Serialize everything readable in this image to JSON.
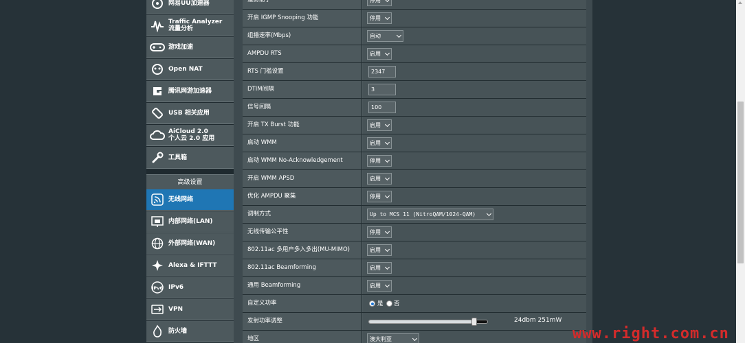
{
  "sidebar": {
    "items": [
      {
        "label": "网易UU加速器",
        "icon": "uu-icon"
      },
      {
        "label": "Traffic Analyzer\n流量分析",
        "icon": "traffic-analyzer-icon"
      },
      {
        "label": "游戏加速",
        "icon": "gamepad-icon"
      },
      {
        "label": "Open NAT",
        "icon": "open-nat-icon"
      },
      {
        "label": "腾讯网游加速器",
        "icon": "tencent-game-icon"
      },
      {
        "label": "USB 相关应用",
        "icon": "usb-icon"
      },
      {
        "label": "AiCloud 2.0\n个人云 2.0 应用",
        "icon": "cloud-icon"
      },
      {
        "label": "工具箱",
        "icon": "wrench-icon"
      }
    ],
    "advanced_header": "高级设置",
    "advanced_items": [
      {
        "label": "无线网络",
        "icon": "wifi-icon",
        "active": true
      },
      {
        "label": "内部网络(LAN)",
        "icon": "lan-icon"
      },
      {
        "label": "外部网络(WAN)",
        "icon": "globe-icon"
      },
      {
        "label": "Alexa & IFTTT",
        "icon": "alexa-icon"
      },
      {
        "label": "IPv6",
        "icon": "ipv6-icon"
      },
      {
        "label": "VPN",
        "icon": "vpn-icon"
      },
      {
        "label": "防火墙",
        "icon": "firewall-icon"
      }
    ]
  },
  "settings": {
    "rows": [
      {
        "label": "漫游助手",
        "type": "select",
        "value": "停用"
      },
      {
        "label": "开启 IGMP Snooping 功能",
        "type": "select",
        "value": "停用"
      },
      {
        "label": "组播速率(Mbps)",
        "type": "select",
        "value": "自动"
      },
      {
        "label": "AMPDU RTS",
        "type": "select",
        "value": "启用"
      },
      {
        "label": "RTS 门槛设置",
        "type": "text",
        "value": "2347"
      },
      {
        "label": "DTIM间隔",
        "type": "text",
        "value": "3"
      },
      {
        "label": "信号间隔",
        "type": "text",
        "value": "100"
      },
      {
        "label": "开启 TX Burst 功能",
        "type": "select",
        "value": "启用"
      },
      {
        "label": "启动 WMM",
        "type": "select",
        "value": "启用"
      },
      {
        "label": "启动 WMM No-Acknowledgement",
        "type": "select",
        "value": "停用"
      },
      {
        "label": "开启 WMM APSD",
        "type": "select",
        "value": "启用"
      },
      {
        "label": "优化 AMPDU 聚集",
        "type": "select",
        "value": "停用"
      },
      {
        "label": "调制方式",
        "type": "select",
        "value": "Up to MCS 11 (NitroQAM/1024-QAM)"
      },
      {
        "label": "无线传输公平性",
        "type": "select",
        "value": "停用"
      },
      {
        "label": "802.11ac 多用户多入多出(MU-MIMO)",
        "type": "select",
        "value": "启用"
      },
      {
        "label": "802.11ac Beamforming",
        "type": "select",
        "value": "启用"
      },
      {
        "label": "通用 Beamforming",
        "type": "select",
        "value": "启用"
      },
      {
        "label": "自定义功率",
        "type": "radio",
        "options": [
          "是",
          "否"
        ],
        "selected": "是"
      },
      {
        "label": "发射功率调整",
        "type": "slider",
        "level": 0.89,
        "value_text": "24dbm 251mW"
      },
      {
        "label": "地区",
        "type": "select",
        "value": "澳大利亚"
      }
    ]
  },
  "watermark": "www.right.com.cn"
}
